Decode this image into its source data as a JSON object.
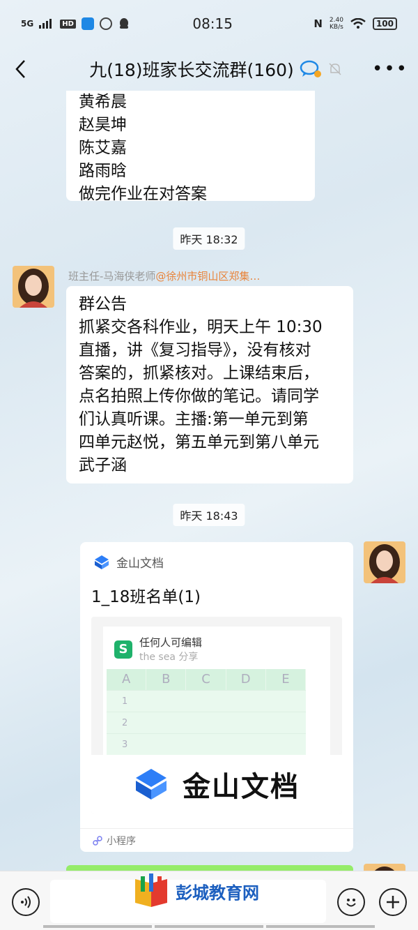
{
  "status_bar": {
    "signal": "5G",
    "hd": "HD",
    "time": "08:15",
    "nfc": "N",
    "net_speed_value": "2.40",
    "net_speed_unit": "KB/s",
    "battery": "100"
  },
  "nav": {
    "title": "九(18)班家长交流群(160)"
  },
  "messages": {
    "msg1": {
      "lines": [
        "黄希晨",
        "赵昊坤",
        "陈艾嘉",
        "路雨晗",
        "做完作业在对答案"
      ]
    },
    "timestamp1": "昨天 18:32",
    "msg2": {
      "sender_name": "班主任-马海侠老师",
      "sender_org": "@徐州市铜山区郑集…",
      "lines": [
        "群公告",
        "抓紧交各科作业，明天上午 10:30",
        "直播，讲《复习指导》，没有核对",
        "答案的，抓紧核对。上课结束后，",
        "点名拍照上传你做的笔记。请同学",
        "们认真听课。主播:第一单元到第",
        "四单元赵悦，第五单元到第八单元",
        "武子涵"
      ]
    },
    "timestamp2": "昨天 18:43",
    "card": {
      "app_name": "金山文档",
      "title": "1_18班名单(1)",
      "preview_title": "任何人可编辑",
      "preview_sub": "the  sea 分享",
      "columns": [
        "A",
        "B",
        "C",
        "D",
        "E"
      ],
      "rows": [
        "1",
        "2",
        "3"
      ],
      "brand": "金山文档",
      "footer": "小程序"
    }
  },
  "watermark": "彭城教育网",
  "colors": {
    "accent_orange": "#e8843b",
    "sheet_green": "#1fb26b",
    "bubble_green": "#95ec69"
  }
}
